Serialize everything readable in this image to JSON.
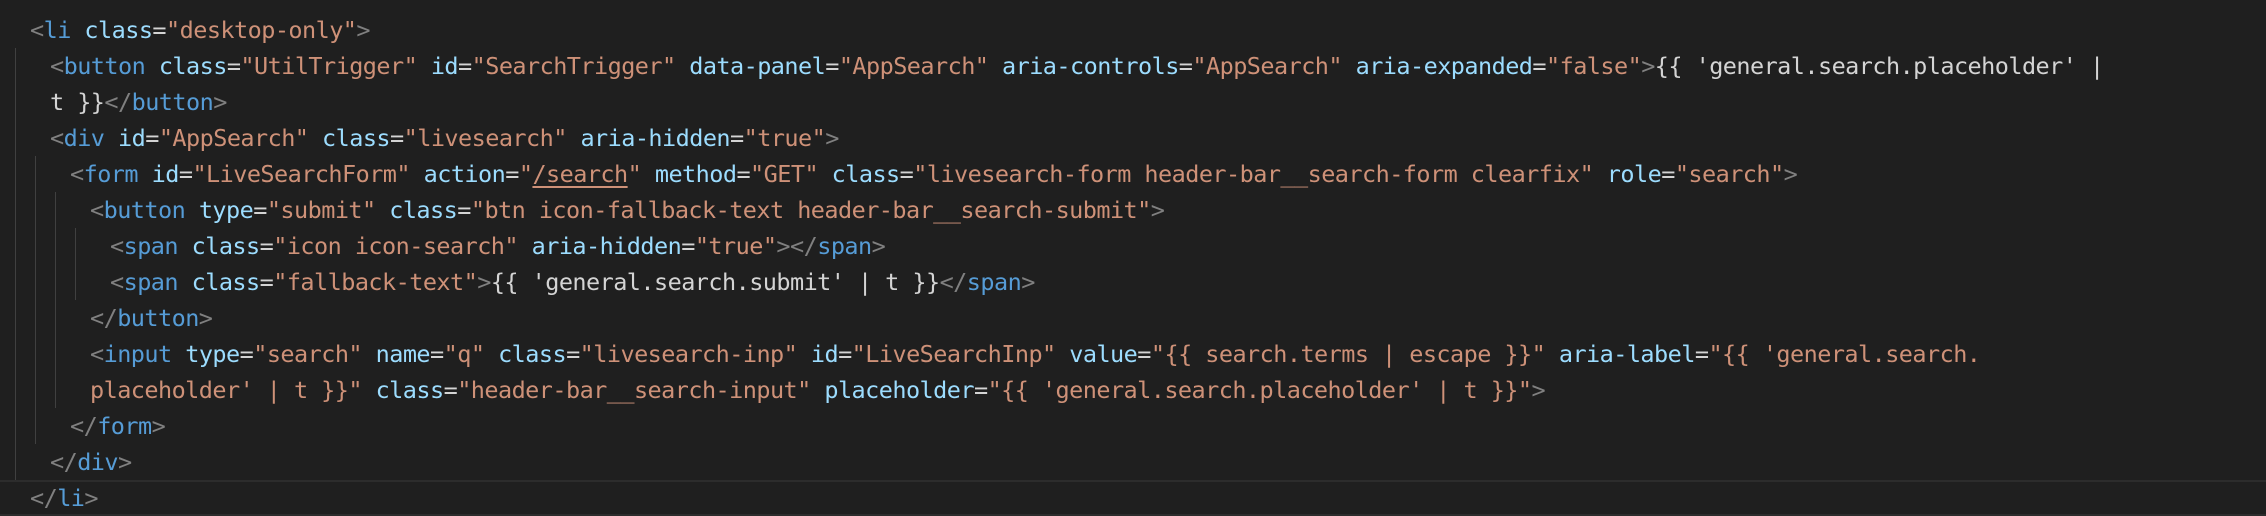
{
  "theme": {
    "background": "#1f1f1f",
    "tag_color": "#569cd6",
    "punctuation_color": "#808080",
    "attribute_color": "#9cdcfe",
    "string_color": "#ce9178",
    "text_color": "#d4d4d4",
    "indent_guide_color": "#404040"
  },
  "lines": [
    {
      "indent": 0,
      "current": false,
      "tokens": [
        {
          "t": "<",
          "c": "pun"
        },
        {
          "t": "li",
          "c": "tag"
        },
        {
          "t": " ",
          "c": "plain"
        },
        {
          "t": "class",
          "c": "attr"
        },
        {
          "t": "=",
          "c": "plain"
        },
        {
          "t": "\"desktop-only\"",
          "c": "str"
        },
        {
          "t": ">",
          "c": "pun"
        }
      ]
    },
    {
      "indent": 1,
      "current": false,
      "tokens": [
        {
          "t": "<",
          "c": "pun"
        },
        {
          "t": "button",
          "c": "tag"
        },
        {
          "t": " ",
          "c": "plain"
        },
        {
          "t": "class",
          "c": "attr"
        },
        {
          "t": "=",
          "c": "plain"
        },
        {
          "t": "\"UtilTrigger\"",
          "c": "str"
        },
        {
          "t": " ",
          "c": "plain"
        },
        {
          "t": "id",
          "c": "attr"
        },
        {
          "t": "=",
          "c": "plain"
        },
        {
          "t": "\"SearchTrigger\"",
          "c": "str"
        },
        {
          "t": " ",
          "c": "plain"
        },
        {
          "t": "data-panel",
          "c": "attr"
        },
        {
          "t": "=",
          "c": "plain"
        },
        {
          "t": "\"AppSearch\"",
          "c": "str"
        },
        {
          "t": " ",
          "c": "plain"
        },
        {
          "t": "aria-controls",
          "c": "attr"
        },
        {
          "t": "=",
          "c": "plain"
        },
        {
          "t": "\"AppSearch\"",
          "c": "str"
        },
        {
          "t": " ",
          "c": "plain"
        },
        {
          "t": "aria-expanded",
          "c": "attr"
        },
        {
          "t": "=",
          "c": "plain"
        },
        {
          "t": "\"false\"",
          "c": "str"
        },
        {
          "t": ">",
          "c": "pun"
        },
        {
          "t": "{{ 'general.search.placeholder' |",
          "c": "plain"
        }
      ]
    },
    {
      "indent": 1,
      "current": false,
      "tokens": [
        {
          "t": "t }}",
          "c": "plain"
        },
        {
          "t": "</",
          "c": "pun"
        },
        {
          "t": "button",
          "c": "tag"
        },
        {
          "t": ">",
          "c": "pun"
        }
      ]
    },
    {
      "indent": 1,
      "current": false,
      "tokens": [
        {
          "t": "<",
          "c": "pun"
        },
        {
          "t": "div",
          "c": "tag"
        },
        {
          "t": " ",
          "c": "plain"
        },
        {
          "t": "id",
          "c": "attr"
        },
        {
          "t": "=",
          "c": "plain"
        },
        {
          "t": "\"AppSearch\"",
          "c": "str"
        },
        {
          "t": " ",
          "c": "plain"
        },
        {
          "t": "class",
          "c": "attr"
        },
        {
          "t": "=",
          "c": "plain"
        },
        {
          "t": "\"livesearch\"",
          "c": "str"
        },
        {
          "t": " ",
          "c": "plain"
        },
        {
          "t": "aria-hidden",
          "c": "attr"
        },
        {
          "t": "=",
          "c": "plain"
        },
        {
          "t": "\"true\"",
          "c": "str"
        },
        {
          "t": ">",
          "c": "pun"
        }
      ]
    },
    {
      "indent": 2,
      "current": false,
      "tokens": [
        {
          "t": "<",
          "c": "pun"
        },
        {
          "t": "form",
          "c": "tag"
        },
        {
          "t": " ",
          "c": "plain"
        },
        {
          "t": "id",
          "c": "attr"
        },
        {
          "t": "=",
          "c": "plain"
        },
        {
          "t": "\"LiveSearchForm\"",
          "c": "str"
        },
        {
          "t": " ",
          "c": "plain"
        },
        {
          "t": "action",
          "c": "attr"
        },
        {
          "t": "=",
          "c": "plain"
        },
        {
          "t": "\"",
          "c": "str"
        },
        {
          "t": "/search",
          "c": "str link"
        },
        {
          "t": "\"",
          "c": "str"
        },
        {
          "t": " ",
          "c": "plain"
        },
        {
          "t": "method",
          "c": "attr"
        },
        {
          "t": "=",
          "c": "plain"
        },
        {
          "t": "\"GET\"",
          "c": "str"
        },
        {
          "t": " ",
          "c": "plain"
        },
        {
          "t": "class",
          "c": "attr"
        },
        {
          "t": "=",
          "c": "plain"
        },
        {
          "t": "\"livesearch-form header-bar__search-form clearfix\"",
          "c": "str"
        },
        {
          "t": " ",
          "c": "plain"
        },
        {
          "t": "role",
          "c": "attr"
        },
        {
          "t": "=",
          "c": "plain"
        },
        {
          "t": "\"search\"",
          "c": "str"
        },
        {
          "t": ">",
          "c": "pun"
        }
      ]
    },
    {
      "indent": 3,
      "current": false,
      "tokens": [
        {
          "t": "<",
          "c": "pun"
        },
        {
          "t": "button",
          "c": "tag"
        },
        {
          "t": " ",
          "c": "plain"
        },
        {
          "t": "type",
          "c": "attr"
        },
        {
          "t": "=",
          "c": "plain"
        },
        {
          "t": "\"submit\"",
          "c": "str"
        },
        {
          "t": " ",
          "c": "plain"
        },
        {
          "t": "class",
          "c": "attr"
        },
        {
          "t": "=",
          "c": "plain"
        },
        {
          "t": "\"btn icon-fallback-text header-bar__search-submit\"",
          "c": "str"
        },
        {
          "t": ">",
          "c": "pun"
        }
      ]
    },
    {
      "indent": 4,
      "current": false,
      "tokens": [
        {
          "t": "<",
          "c": "pun"
        },
        {
          "t": "span",
          "c": "tag"
        },
        {
          "t": " ",
          "c": "plain"
        },
        {
          "t": "class",
          "c": "attr"
        },
        {
          "t": "=",
          "c": "plain"
        },
        {
          "t": "\"icon icon-search\"",
          "c": "str"
        },
        {
          "t": " ",
          "c": "plain"
        },
        {
          "t": "aria-hidden",
          "c": "attr"
        },
        {
          "t": "=",
          "c": "plain"
        },
        {
          "t": "\"true\"",
          "c": "str"
        },
        {
          "t": "></",
          "c": "pun"
        },
        {
          "t": "span",
          "c": "tag"
        },
        {
          "t": ">",
          "c": "pun"
        }
      ]
    },
    {
      "indent": 4,
      "current": false,
      "tokens": [
        {
          "t": "<",
          "c": "pun"
        },
        {
          "t": "span",
          "c": "tag"
        },
        {
          "t": " ",
          "c": "plain"
        },
        {
          "t": "class",
          "c": "attr"
        },
        {
          "t": "=",
          "c": "plain"
        },
        {
          "t": "\"fallback-text\"",
          "c": "str"
        },
        {
          "t": ">",
          "c": "pun"
        },
        {
          "t": "{{ 'general.search.submit' | t }}",
          "c": "plain"
        },
        {
          "t": "</",
          "c": "pun"
        },
        {
          "t": "span",
          "c": "tag"
        },
        {
          "t": ">",
          "c": "pun"
        }
      ]
    },
    {
      "indent": 3,
      "current": false,
      "tokens": [
        {
          "t": "</",
          "c": "pun"
        },
        {
          "t": "button",
          "c": "tag"
        },
        {
          "t": ">",
          "c": "pun"
        }
      ]
    },
    {
      "indent": 3,
      "current": false,
      "tokens": [
        {
          "t": "<",
          "c": "pun"
        },
        {
          "t": "input",
          "c": "tag"
        },
        {
          "t": " ",
          "c": "plain"
        },
        {
          "t": "type",
          "c": "attr"
        },
        {
          "t": "=",
          "c": "plain"
        },
        {
          "t": "\"search\"",
          "c": "str"
        },
        {
          "t": " ",
          "c": "plain"
        },
        {
          "t": "name",
          "c": "attr"
        },
        {
          "t": "=",
          "c": "plain"
        },
        {
          "t": "\"q\"",
          "c": "str"
        },
        {
          "t": " ",
          "c": "plain"
        },
        {
          "t": "class",
          "c": "attr"
        },
        {
          "t": "=",
          "c": "plain"
        },
        {
          "t": "\"livesearch-inp\"",
          "c": "str"
        },
        {
          "t": " ",
          "c": "plain"
        },
        {
          "t": "id",
          "c": "attr"
        },
        {
          "t": "=",
          "c": "plain"
        },
        {
          "t": "\"LiveSearchInp\"",
          "c": "str"
        },
        {
          "t": " ",
          "c": "plain"
        },
        {
          "t": "value",
          "c": "attr"
        },
        {
          "t": "=",
          "c": "plain"
        },
        {
          "t": "\"{{ search.terms | escape }}\"",
          "c": "str"
        },
        {
          "t": " ",
          "c": "plain"
        },
        {
          "t": "aria-label",
          "c": "attr"
        },
        {
          "t": "=",
          "c": "plain"
        },
        {
          "t": "\"{{ 'general.search.",
          "c": "str"
        }
      ]
    },
    {
      "indent": 3,
      "current": false,
      "tokens": [
        {
          "t": "placeholder' | t }}\"",
          "c": "str"
        },
        {
          "t": " ",
          "c": "plain"
        },
        {
          "t": "class",
          "c": "attr"
        },
        {
          "t": "=",
          "c": "plain"
        },
        {
          "t": "\"header-bar__search-input\"",
          "c": "str"
        },
        {
          "t": " ",
          "c": "plain"
        },
        {
          "t": "placeholder",
          "c": "attr"
        },
        {
          "t": "=",
          "c": "plain"
        },
        {
          "t": "\"{{ 'general.search.placeholder' | t }}\"",
          "c": "str"
        },
        {
          "t": ">",
          "c": "pun"
        }
      ]
    },
    {
      "indent": 2,
      "current": false,
      "tokens": [
        {
          "t": "</",
          "c": "pun"
        },
        {
          "t": "form",
          "c": "tag"
        },
        {
          "t": ">",
          "c": "pun"
        }
      ]
    },
    {
      "indent": 1,
      "current": false,
      "tokens": [
        {
          "t": "</",
          "c": "pun"
        },
        {
          "t": "div",
          "c": "tag"
        },
        {
          "t": ">",
          "c": "pun"
        }
      ]
    },
    {
      "indent": 0,
      "current": true,
      "tokens": [
        {
          "t": "</",
          "c": "pun"
        },
        {
          "t": "li",
          "c": "tag"
        },
        {
          "t": ">",
          "c": "pun"
        }
      ]
    }
  ]
}
